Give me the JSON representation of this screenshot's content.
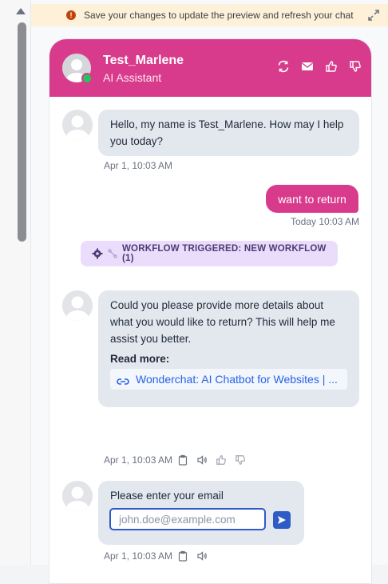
{
  "banner": {
    "text": "Save your changes to update the preview and refresh your chat",
    "icon": "warning-icon"
  },
  "header": {
    "bot_name": "Test_Marlene",
    "bot_role": "AI Assistant",
    "accent": "#d93b8c"
  },
  "messages": {
    "greeting": {
      "text": "Hello, my name is Test_Marlene. How may I help you today?",
      "time": "Apr 1, 10:03 AM"
    },
    "user": {
      "text": "want to return",
      "time": "Today 10:03 AM"
    },
    "workflow": {
      "text": "WORKFLOW TRIGGERED: NEW WORKFLOW (1)"
    },
    "details": {
      "text": "Could you please provide more details about what you would like to return? This will help me assist you better.",
      "read_more_label": "Read more:",
      "link_text": "Wonderchat: AI Chatbot for Websites | ...",
      "time": "Apr 1, 10:03 AM"
    },
    "email_prompt": {
      "text": "Please enter your email",
      "placeholder": "john.doe@example.com",
      "time": "Apr 1, 10:03 AM"
    }
  }
}
